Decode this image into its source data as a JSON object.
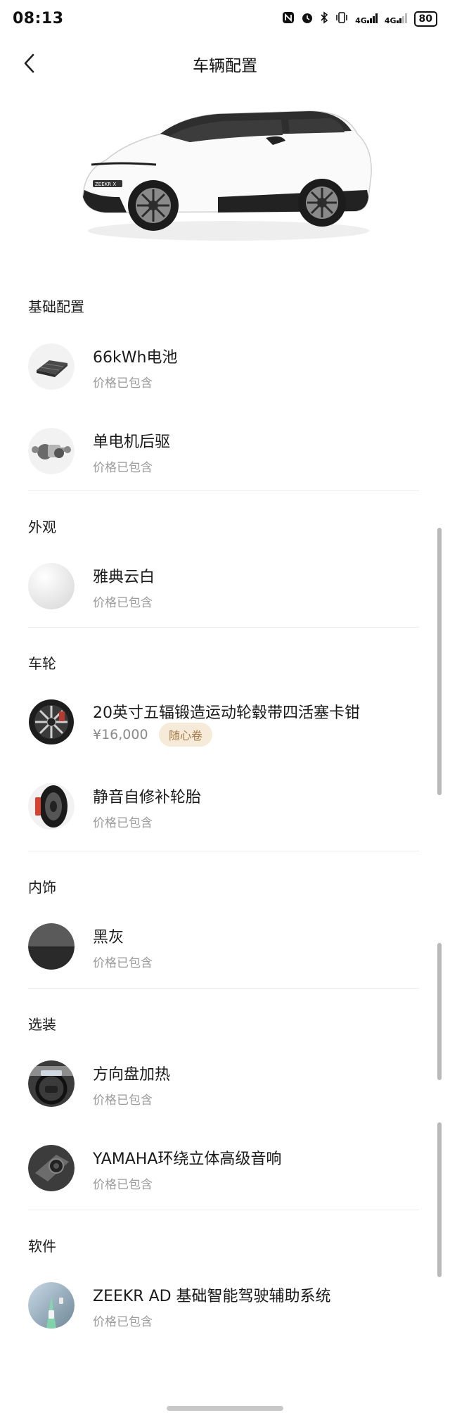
{
  "status_bar": {
    "time": "08:13",
    "network_1": "4G",
    "network_2": "4G",
    "battery": "80"
  },
  "header": {
    "title": "车辆配置"
  },
  "sections": [
    {
      "title": "基础配置",
      "items": [
        {
          "name": "66kWh电池",
          "sub": "价格已包含",
          "icon": "battery-pack-icon"
        },
        {
          "name": "单电机后驱",
          "sub": "价格已包含",
          "icon": "rear-motor-icon"
        }
      ]
    },
    {
      "title": "外观",
      "items": [
        {
          "name": "雅典云白",
          "sub": "价格已包含",
          "icon": "white-paint-swatch"
        }
      ]
    },
    {
      "title": "车轮",
      "items": [
        {
          "name": "20英寸五辐锻造运动轮毂带四活塞卡钳",
          "price": "¥16,000",
          "badge": "随心卷",
          "icon": "wheel-icon"
        },
        {
          "name": "静音自修补轮胎",
          "sub": "价格已包含",
          "icon": "tire-icon"
        }
      ]
    },
    {
      "title": "内饰",
      "items": [
        {
          "name": "黑灰",
          "sub": "价格已包含",
          "icon": "interior-color-swatch"
        }
      ]
    },
    {
      "title": "选装",
      "items": [
        {
          "name": "方向盘加热",
          "sub": "价格已包含",
          "icon": "steering-wheel-icon"
        },
        {
          "name": "YAMAHA环绕立体高级音响",
          "sub": "价格已包含",
          "icon": "speaker-icon"
        }
      ]
    },
    {
      "title": "软件",
      "items": [
        {
          "name": "ZEEKR AD 基础智能驾驶辅助系统",
          "sub": "价格已包含",
          "icon": "driving-assist-icon"
        }
      ]
    }
  ],
  "car": {
    "badge": "ZEEKR X"
  },
  "colors": {
    "coupon_bg": "#f6ead9",
    "coupon_text": "#a57c47",
    "sub_text": "#9b9b9b"
  }
}
